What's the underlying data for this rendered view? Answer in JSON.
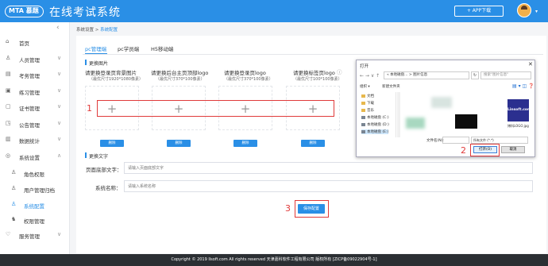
{
  "header": {
    "logo_text": "MTA 慕题",
    "title": "在线考试系统",
    "app_download": "+ APP下载",
    "avatar_caret": "▾"
  },
  "sidebar": {
    "collapse_icon": "‹",
    "items": [
      {
        "label": "首页",
        "icon": "home-icon",
        "glyph": "⌂",
        "chevron": ""
      },
      {
        "label": "人员管理",
        "icon": "user-icon",
        "glyph": "♙",
        "chevron": "∨"
      },
      {
        "label": "考务管理",
        "icon": "calendar-icon",
        "glyph": "▤",
        "chevron": "∨"
      },
      {
        "label": "练习管理",
        "icon": "document-icon",
        "glyph": "▣",
        "chevron": "∨"
      },
      {
        "label": "证书管理",
        "icon": "certificate-icon",
        "glyph": "▢",
        "chevron": "∨"
      },
      {
        "label": "公告管理",
        "icon": "notice-icon",
        "glyph": "◳",
        "chevron": "∨"
      },
      {
        "label": "数据统计",
        "icon": "stats-icon",
        "glyph": "▥",
        "chevron": "∨"
      },
      {
        "label": "系统设置",
        "icon": "settings-icon",
        "glyph": "◎",
        "chevron": "∧"
      },
      {
        "label": "角色权限",
        "icon": "role-icon",
        "glyph": "♙",
        "chevron": ""
      },
      {
        "label": "用户管理归档",
        "icon": "user-archive-icon",
        "glyph": "♙",
        "chevron": ""
      },
      {
        "label": "系统配置",
        "icon": "config-icon",
        "glyph": "♙",
        "chevron": ""
      },
      {
        "label": "权限管理",
        "icon": "permission-icon",
        "glyph": "♞",
        "chevron": ""
      },
      {
        "label": "服务管理",
        "icon": "service-icon",
        "glyph": "♡",
        "chevron": "∨"
      }
    ]
  },
  "breadcrumb": {
    "root": "系统设置",
    "sep": " > ",
    "current": "系统配置"
  },
  "tabs": [
    "pc管理端",
    "pc学员端",
    "H5移动端"
  ],
  "sections": {
    "images": "更换图片",
    "text": "更换文字"
  },
  "image_slots": [
    {
      "label": "请更换登录页背景图片",
      "size": "（最优尺寸1920*1080像素）",
      "plus": "+",
      "delete": "删除"
    },
    {
      "label": "请更换后台主页顶部logo",
      "size": "（最优尺寸370*100像素）",
      "plus": "+",
      "delete": "删除"
    },
    {
      "label": "请更换登录页logo",
      "size": "（最优尺寸370*100像素）",
      "plus": "+",
      "delete": "删除"
    },
    {
      "label": "请更换标签页logo",
      "size": "（最优尺寸100*100像素）",
      "plus": "+",
      "delete": "删除"
    }
  ],
  "info_icon": "ⓘ",
  "form": {
    "footer_label": "页面底部文字：",
    "footer_placeholder": "请输入页面底部文字",
    "sysname_label": "系统名称：",
    "sysname_placeholder": "请输入系统名称",
    "save": "保存配置"
  },
  "annotations": [
    "1",
    "2",
    "3"
  ],
  "dialog": {
    "title": "打开",
    "close": "✕",
    "nav": "← → ∨ ↑",
    "path": "« 本地磁盘... > 图片信息",
    "refresh": "↻",
    "search": "搜索\"图片信息\"",
    "organize": "组织 ▾",
    "new_folder": "新建文件夹",
    "view": "▤ ▾ ◫ ❓",
    "tree": [
      "文档",
      "下载",
      "音乐",
      "本地磁盘 (C:)",
      "本地磁盘 (D:)",
      "本地磁盘 (E:)"
    ],
    "logo_thumb_text": "Linsoft.com",
    "thumb_caption": "博科LOGO.jpg",
    "filename_label": "文件名(N):",
    "filter": "所有文件 (*.*)",
    "open": "打开(O)",
    "cancel": "取消"
  },
  "footer": "Copyright © 2019 llsoft.com All rights reserved 天津嘉科软件工程有限公司 版权所有 [ZICP备09022904号-1]",
  "colors": {
    "accent": "#2a8fe6",
    "annotation": "#e03a3a"
  }
}
